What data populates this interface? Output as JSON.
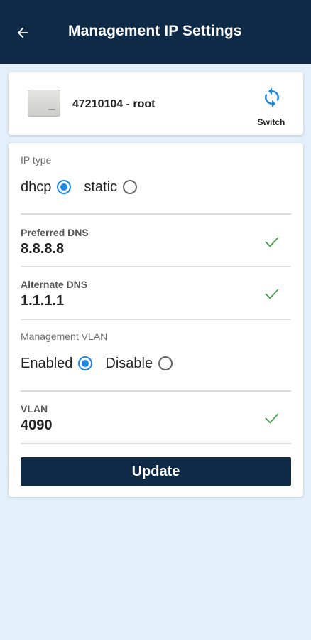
{
  "appbar": {
    "title": "Management IP Settings",
    "back_icon": "arrow-left-icon"
  },
  "device": {
    "name": "47210104 - root",
    "switch_label": "Switch",
    "switch_icon": "refresh-icon"
  },
  "ip_type": {
    "label": "IP type",
    "options": [
      {
        "label": "dhcp",
        "selected": true
      },
      {
        "label": "static",
        "selected": false
      }
    ]
  },
  "preferred_dns": {
    "label": "Preferred DNS",
    "value": "8.8.8.8",
    "valid": true
  },
  "alternate_dns": {
    "label": "Alternate DNS",
    "value": "1.1.1.1",
    "valid": true
  },
  "management_vlan": {
    "label": "Management VLAN",
    "options": [
      {
        "label": "Enabled",
        "selected": true
      },
      {
        "label": "Disable",
        "selected": false
      }
    ]
  },
  "vlan": {
    "label": "VLAN",
    "value": "4090",
    "valid": true
  },
  "update_label": "Update",
  "colors": {
    "header": "#0e2a47",
    "accent": "#1e88e5",
    "check": "#43a047",
    "background": "#e3effa"
  }
}
